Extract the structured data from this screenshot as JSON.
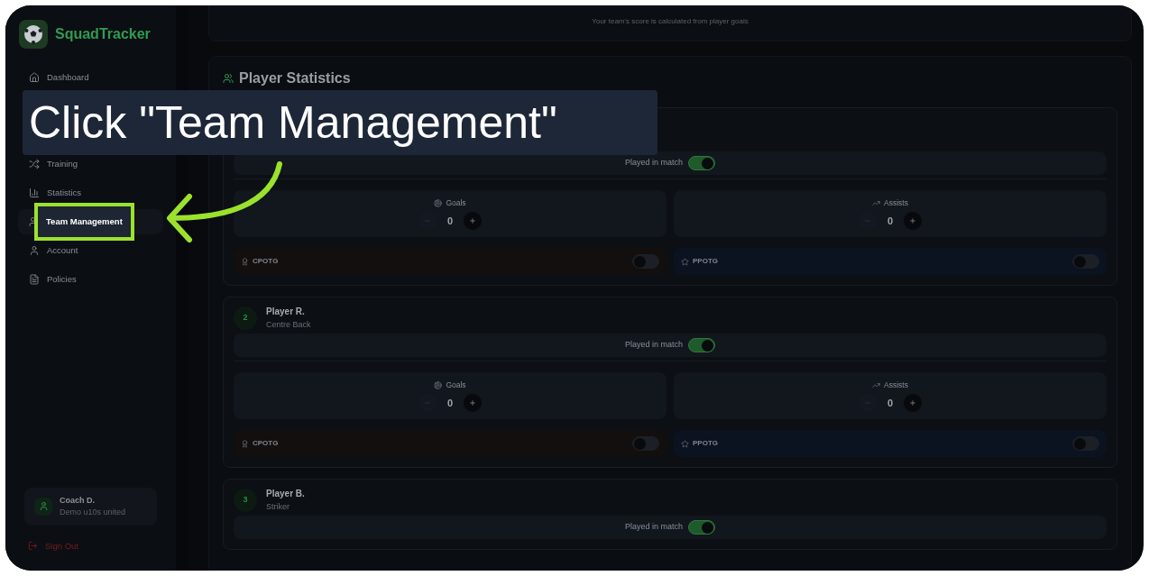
{
  "app": {
    "name": "SquadTracker"
  },
  "nav": [
    {
      "label": "Dashboard",
      "highlighted": false
    },
    {
      "label": "Training",
      "highlighted": false
    },
    {
      "label": "Statistics",
      "highlighted": false
    },
    {
      "label": "Team Management",
      "highlighted": true
    },
    {
      "label": "Account",
      "highlighted": false
    },
    {
      "label": "Policies",
      "highlighted": false
    }
  ],
  "user": {
    "name": "Coach D.",
    "team": "Demo u10s united"
  },
  "sign_out": "Sign Out",
  "score_note": "Your team's score is calculated from player goals",
  "section_title": "Player Statistics",
  "players": [
    {
      "played_label": "Played in match",
      "played": true,
      "goals_label": "Goals",
      "goals": "0",
      "assists_label": "Assists",
      "assists": "0",
      "cpotg_label": "CPOTG",
      "cpotg": false,
      "ppotg_label": "PPOTG",
      "ppotg": false
    },
    {
      "number": "2",
      "name": "Player R.",
      "position": "Centre Back",
      "played_label": "Played in match",
      "played": true,
      "goals_label": "Goals",
      "goals": "0",
      "assists_label": "Assists",
      "assists": "0",
      "cpotg_label": "CPOTG",
      "cpotg": false,
      "ppotg_label": "PPOTG",
      "ppotg": false
    },
    {
      "number": "3",
      "name": "Player B.",
      "position": "Striker",
      "played_label": "Played in match",
      "played": true
    }
  ],
  "tutorial": {
    "callout": "Click \"Team Management\""
  }
}
